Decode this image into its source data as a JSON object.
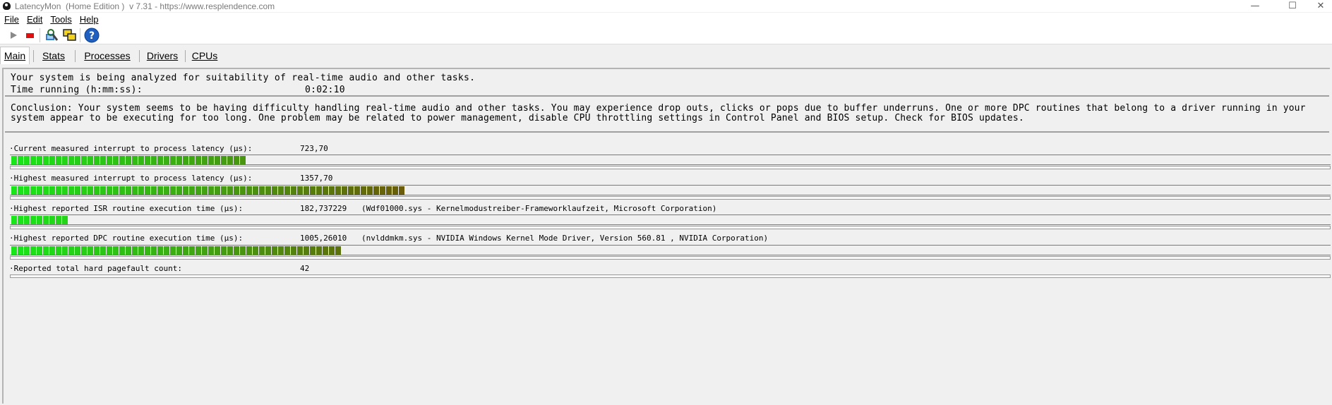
{
  "window": {
    "title": "LatencyMon  (Home Edition )  v 7.31 - https://www.resplendence.com",
    "minimize_glyph": "—",
    "maximize_glyph": "☐",
    "close_glyph": "✕"
  },
  "menu": [
    {
      "label": "File"
    },
    {
      "label": "Edit"
    },
    {
      "label": "Tools"
    },
    {
      "label": "Help"
    }
  ],
  "toolbar": {
    "icons": [
      "play-icon",
      "stop-icon",
      "driver-search-icon",
      "windows-icon",
      "help-icon"
    ]
  },
  "tabs": [
    {
      "label": "Main",
      "active": true
    },
    {
      "label": "Stats",
      "active": false
    },
    {
      "label": "Processes",
      "active": false
    },
    {
      "label": "Drivers",
      "active": false
    },
    {
      "label": "CPUs",
      "active": false
    }
  ],
  "status": {
    "line1": "Your system is being analyzed for suitability of real-time audio and other tasks.",
    "time_label": "Time running (h:mm:ss):",
    "time_value": "0:02:10"
  },
  "conclusion": {
    "line1": "Conclusion: Your system seems to be having difficulty handling real-time audio and other tasks. You may experience drop outs, clicks or pops due to buffer underruns. One or more DPC routines that belong to a driver running in your",
    "line2": "system appear to be executing for too long. One problem may be related to power management, disable CPU throttling settings in Control Panel and BIOS setup. Check for BIOS updates."
  },
  "metrics": [
    {
      "label": "·Current measured interrupt to process latency (µs):",
      "value": "723,70",
      "detail": "",
      "segments": 37
    },
    {
      "label": "·Highest measured interrupt to process latency (µs):",
      "value": "1357,70",
      "detail": "",
      "segments": 62
    },
    {
      "label": "·Highest reported ISR routine execution time (µs):",
      "value": "182,737229",
      "detail": "(Wdf01000.sys - Kernelmodustreiber-Frameworklaufzeit, Microsoft Corporation)",
      "segments": 9
    },
    {
      "label": "·Highest reported DPC routine execution time (µs):",
      "value": "1005,26010",
      "detail": "(nvlddmkm.sys - NVIDIA Windows Kernel Mode Driver, Version 560.81 , NVIDIA Corporation)",
      "segments": 52
    },
    {
      "label": "·Reported total hard pagefault count:",
      "value": "42",
      "detail": "",
      "segments": 0
    }
  ],
  "colors": {
    "bar_start": "#19e619",
    "bar_end": "#6b5a0a"
  }
}
